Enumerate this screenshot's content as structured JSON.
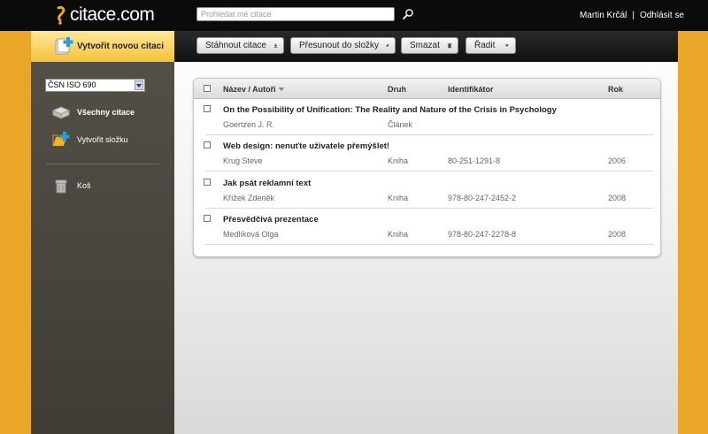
{
  "brand": {
    "name": "citace.com"
  },
  "search": {
    "placeholder": "Prohledat mé citace"
  },
  "user": {
    "name": "Martin Krčál",
    "separator": "|",
    "logout": "Odhlásit se"
  },
  "new_citation": {
    "label": "Vytvořit novou citaci"
  },
  "toolbar": {
    "download": "Stáhnout citace",
    "move": "Přesunout do složky",
    "delete": "Smazat",
    "sort": "Řadit"
  },
  "sidebar": {
    "style_select": "ČSN ISO 690",
    "all_citations": "Všechny citace",
    "create_folder": "Vytvořit složku",
    "trash": "Koš"
  },
  "table": {
    "headers": {
      "title_author": "Název / Autoři",
      "type": "Druh",
      "identifier": "Identifikátor",
      "year": "Rok"
    },
    "rows": [
      {
        "title": "On the Possibility of Unification: The Reality and Nature of the Crisis in Psychology",
        "author": "Goertzen J. R.",
        "type": "Článek",
        "identifier": "",
        "year": ""
      },
      {
        "title": "Web design: nenuťte uživatele přemýšlet!",
        "author": "Krug Steve",
        "type": "Kniha",
        "identifier": "80-251-1291-8",
        "year": "2006"
      },
      {
        "title": "Jak psát reklamní text",
        "author": "Křížek Zdeněk",
        "type": "Kniha",
        "identifier": "978-80-247-2452-2",
        "year": "2008"
      },
      {
        "title": "Přesvědčivá prezentace",
        "author": "Medlíková Olga",
        "type": "Kniha",
        "identifier": "978-80-247-2278-8",
        "year": "2008"
      }
    ]
  },
  "colors": {
    "accent": "#e9a628",
    "topbar": "#0b0b0b",
    "sidebar": "#4a4741",
    "checkbox": "#5b78a6"
  }
}
